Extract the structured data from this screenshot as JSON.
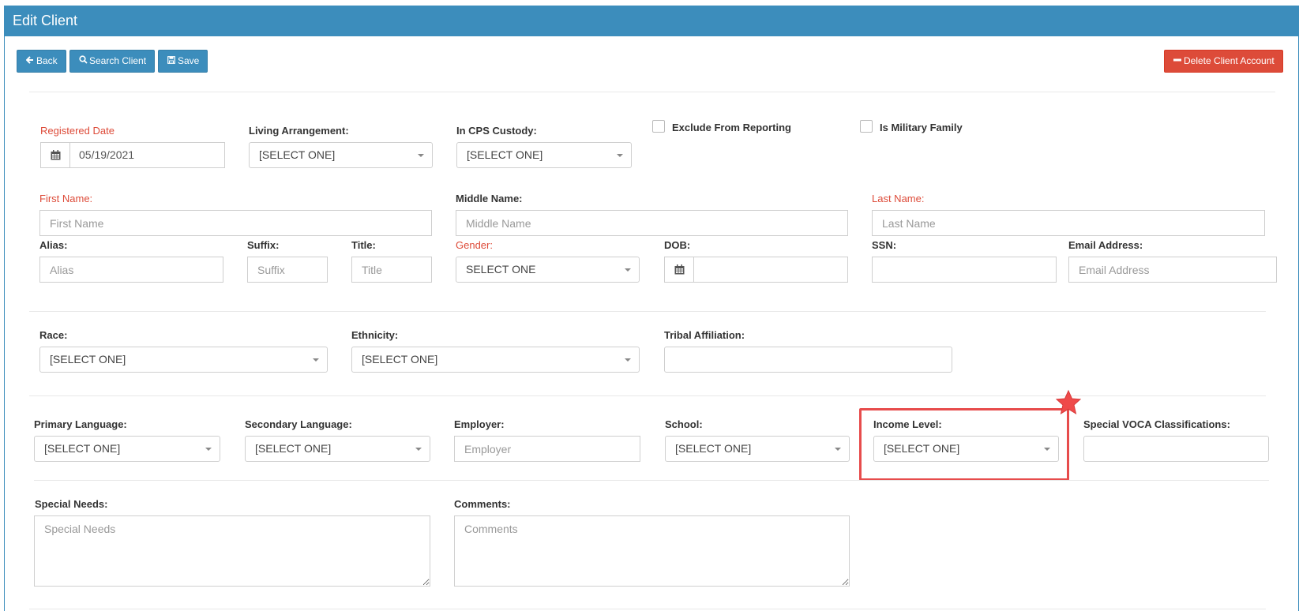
{
  "header": {
    "title": "Edit Client"
  },
  "toolbar": {
    "back_label": "Back",
    "search_label": "Search Client",
    "save_label": "Save",
    "delete_label": "Delete Client Account"
  },
  "form": {
    "registered_date": {
      "label": "Registered Date",
      "value": "05/19/2021"
    },
    "living_arrangement": {
      "label": "Living Arrangement:",
      "value": "[SELECT ONE]"
    },
    "cps_custody": {
      "label": "In CPS Custody:",
      "value": "[SELECT ONE]"
    },
    "exclude_reporting": {
      "label": "Exclude From Reporting",
      "checked": false
    },
    "military_family": {
      "label": "Is Military Family",
      "checked": false
    },
    "first_name": {
      "label": "First Name:",
      "placeholder": "First Name"
    },
    "middle_name": {
      "label": "Middle Name:",
      "placeholder": "Middle Name"
    },
    "last_name": {
      "label": "Last Name:",
      "placeholder": "Last Name"
    },
    "alias": {
      "label": "Alias:",
      "placeholder": "Alias"
    },
    "suffix": {
      "label": "Suffix:",
      "placeholder": "Suffix"
    },
    "title": {
      "label": "Title:",
      "placeholder": "Title"
    },
    "gender": {
      "label": "Gender:",
      "value": "SELECT ONE"
    },
    "dob": {
      "label": "DOB:",
      "value": ""
    },
    "ssn": {
      "label": "SSN:",
      "value": ""
    },
    "email": {
      "label": "Email Address:",
      "placeholder": "Email Address"
    },
    "race": {
      "label": "Race:",
      "value": "[SELECT ONE]"
    },
    "ethnicity": {
      "label": "Ethnicity:",
      "value": "[SELECT ONE]"
    },
    "tribal": {
      "label": "Tribal Affiliation:",
      "value": ""
    },
    "primary_language": {
      "label": "Primary Language:",
      "value": "[SELECT ONE]"
    },
    "secondary_language": {
      "label": "Secondary Language:",
      "value": "[SELECT ONE]"
    },
    "employer": {
      "label": "Employer:",
      "placeholder": "Employer"
    },
    "school": {
      "label": "School:",
      "value": "[SELECT ONE]"
    },
    "income_level": {
      "label": "Income Level:",
      "value": "[SELECT ONE]"
    },
    "voca": {
      "label": "Special VOCA Classifications:",
      "value": ""
    },
    "special_needs": {
      "label": "Special Needs:",
      "placeholder": "Special Needs"
    },
    "comments": {
      "label": "Comments:",
      "placeholder": "Comments"
    }
  },
  "colors": {
    "primary": "#3c8dbc",
    "danger": "#dd4b39",
    "required_label": "#dd4b39",
    "highlight": "#e74c4c"
  },
  "icons": {
    "back": "arrow-left-icon",
    "search": "search-icon",
    "save": "floppy-disk-icon",
    "delete": "minus-icon",
    "calendar": "calendar-icon",
    "star": "star-icon"
  }
}
